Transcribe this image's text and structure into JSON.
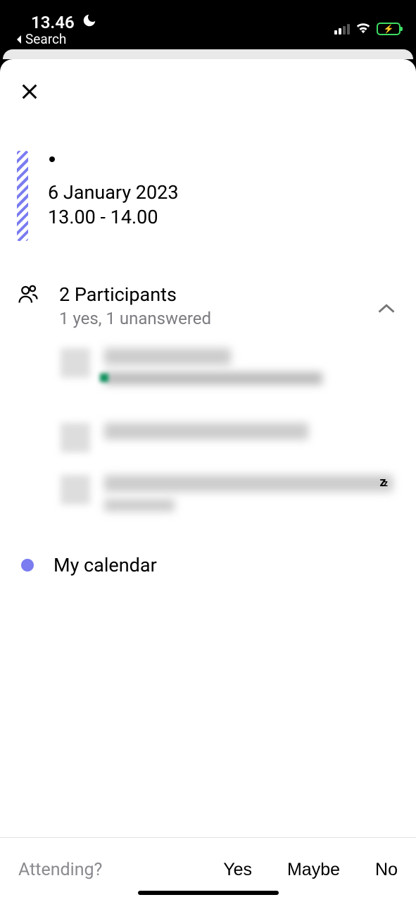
{
  "statusBar": {
    "time": "13.46",
    "backLabel": "Search"
  },
  "event": {
    "title": "•",
    "date": "6 January 2023",
    "time": "13.00 - 14.00"
  },
  "participants": {
    "title": "2 Participants",
    "summary": "1 yes, 1 unanswered",
    "items": [
      {
        "name": "(redacted)",
        "detail": "(redacted)"
      },
      {
        "name": "(redacted)",
        "detail": ""
      },
      {
        "name": "(redacted)",
        "detail": "(redacted)",
        "status": "zz"
      }
    ]
  },
  "calendar": {
    "label": "My calendar",
    "color": "#7a7cf0"
  },
  "rsvp": {
    "prompt": "Attending?",
    "options": {
      "yes": "Yes",
      "maybe": "Maybe",
      "no": "No"
    }
  }
}
